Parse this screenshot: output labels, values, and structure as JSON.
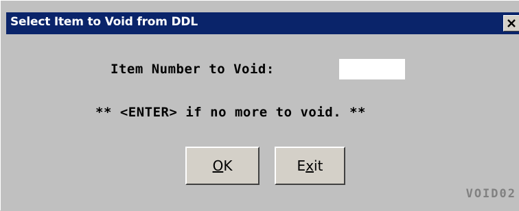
{
  "window": {
    "title": "Select Item to Void from DDL",
    "close_symbol": "✕"
  },
  "form": {
    "prompt_label": "Item Number to Void:",
    "item_number_value": "",
    "item_number_placeholder": "",
    "hint": "** <ENTER> if no more to void. **"
  },
  "buttons": {
    "ok": {
      "mnemonic": "O",
      "rest": "K"
    },
    "exit": {
      "prefix": "E",
      "mnemonic": "x",
      "rest": "it"
    }
  },
  "footer": {
    "screen_id": "VOID02"
  },
  "colors": {
    "titlebar": "#0a246a",
    "window_bg": "#c0c0c0",
    "button_face": "#d4d0c8",
    "screen_id_text": "#808080"
  },
  "icons": {
    "close": "close-icon"
  }
}
